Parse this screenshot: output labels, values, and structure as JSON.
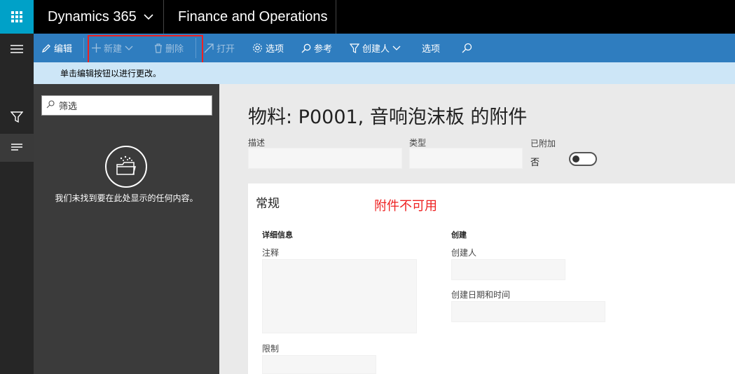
{
  "topbar": {
    "app_name": "Dynamics 365",
    "module_name": "Finance and Operations"
  },
  "actions": {
    "edit": "编辑",
    "new": "新建",
    "delete": "删除",
    "open": "打开",
    "options1": "选项",
    "reference": "参考",
    "created_by": "创建人",
    "options2": "选项"
  },
  "info": {
    "message": "单击编辑按钮以进行更改。"
  },
  "left_pane": {
    "filter_placeholder": "筛选",
    "empty_message": "我们未找到要在此处显示的任何内容。"
  },
  "main": {
    "title": "物料: P0001, 音响泡沫板 的附件",
    "description_label": "描述",
    "type_label": "类型",
    "attached_label": "已附加",
    "attached_value": "否"
  },
  "general": {
    "title": "常规",
    "annotation": "附件不可用",
    "details_header": "详细信息",
    "notes_label": "注释",
    "restriction_label": "限制",
    "created_header": "创建",
    "created_by_label": "创建人",
    "created_datetime_label": "创建日期和时间"
  },
  "colors": {
    "accent": "#00a1c8",
    "actionbar": "#2f7dbf",
    "highlight": "#e22222"
  }
}
